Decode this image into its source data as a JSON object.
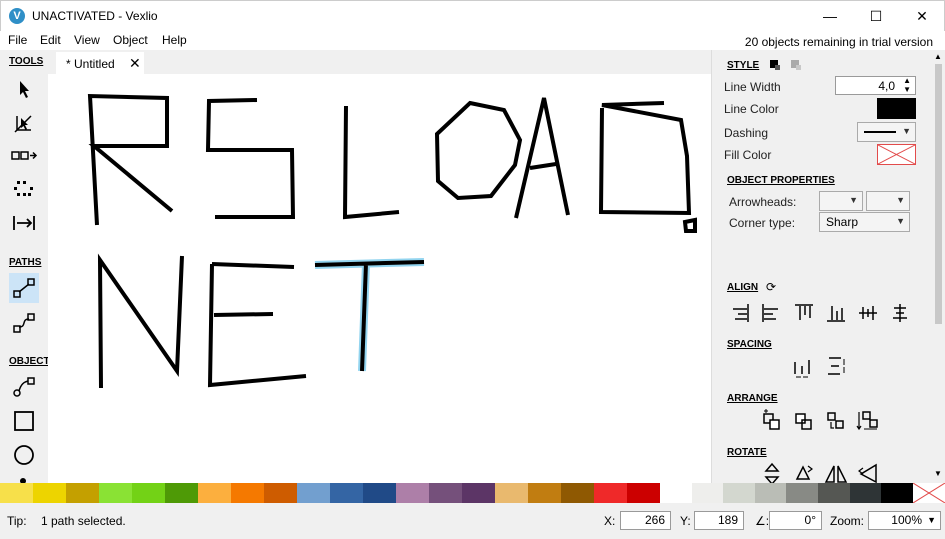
{
  "window": {
    "title": "UNACTIVATED - Vexlio",
    "logo_letter": "V",
    "minimize": "—",
    "maximize": "☐",
    "close": "✕"
  },
  "menu": {
    "items": [
      "File",
      "Edit",
      "View",
      "Object",
      "Help"
    ],
    "trial_notice": "20 objects remaining in trial version"
  },
  "tools": {
    "tools_title": "TOOLS",
    "paths_title": "PATHS",
    "objects_title": "OBJECTS"
  },
  "tab": {
    "label": "* Untitled",
    "close": "✕"
  },
  "canvas": {
    "selected_path_color": "#6ec6ea"
  },
  "style_panel": {
    "title": "STYLE",
    "line_width_label": "Line Width",
    "line_width_value": "4,0",
    "line_color_label": "Line Color",
    "line_color_value": "#000000",
    "dashing_label": "Dashing",
    "fill_color_label": "Fill Color"
  },
  "object_properties": {
    "title": "OBJECT PROPERTIES",
    "arrowheads_label": "Arrowheads:",
    "corner_type_label": "Corner type:",
    "corner_type_value": "Sharp"
  },
  "align": {
    "title": "ALIGN"
  },
  "spacing": {
    "title": "SPACING"
  },
  "arrange": {
    "title": "ARRANGE"
  },
  "rotate": {
    "title": "ROTATE"
  },
  "palette": {
    "colors": [
      "#f7e04a",
      "#edd400",
      "#c4a000",
      "#8ae234",
      "#73d216",
      "#4e9a06",
      "#fcaf3e",
      "#f57900",
      "#ce5c00",
      "#729fcf",
      "#3465a4",
      "#204a87",
      "#ad7fa8",
      "#75507b",
      "#5c3566",
      "#e9b96e",
      "#c17d11",
      "#8f5902",
      "#ef2929",
      "#cc0000",
      "#a40000",
      "#ffffff",
      "#eeeeec",
      "#d3d7cf",
      "#babdb6",
      "#888a85",
      "#555753",
      "#2e3436",
      "#000000"
    ]
  },
  "status": {
    "tip_label": "Tip:",
    "tip_text": "1 path selected.",
    "x_label": "X:",
    "x_value": "266",
    "y_label": "Y:",
    "y_value": "189",
    "angle_label": "∠:",
    "angle_value": "0°",
    "zoom_label": "Zoom:",
    "zoom_value": "100%"
  }
}
